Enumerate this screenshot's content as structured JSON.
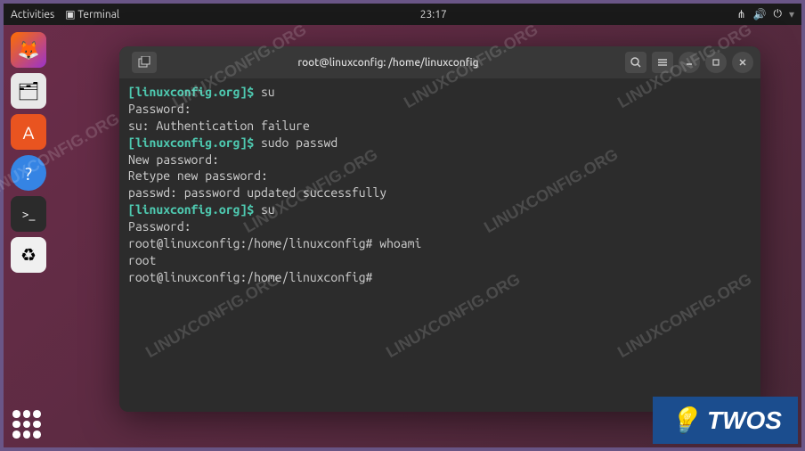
{
  "topbar": {
    "activities": "Activities",
    "app_label": "Terminal",
    "clock": "23:17"
  },
  "dock": {
    "firefox": "firefox",
    "files": "files",
    "software": "software",
    "help": "help",
    "terminal": "terminal",
    "trash": "trash",
    "apps": "apps"
  },
  "window": {
    "title": "root@linuxconfig: /home/linuxconfig",
    "titlebar": {
      "new_tab": "new-tab",
      "search": "search",
      "menu": "menu",
      "minimize": "minimize",
      "maximize": "maximize",
      "close": "close"
    }
  },
  "terminal": {
    "lines": [
      {
        "prompt": "[linuxconfig.org]$ ",
        "cmd": "su"
      },
      {
        "text": "Password:"
      },
      {
        "text": "su: Authentication failure"
      },
      {
        "prompt": "[linuxconfig.org]$ ",
        "cmd": "sudo passwd"
      },
      {
        "text": "New password:"
      },
      {
        "text": "Retype new password:"
      },
      {
        "text": "passwd: password updated successfully"
      },
      {
        "prompt": "[linuxconfig.org]$ ",
        "cmd": "su"
      },
      {
        "text": "Password:"
      },
      {
        "text": "root@linuxconfig:/home/linuxconfig# whoami"
      },
      {
        "text": "root"
      },
      {
        "text": "root@linuxconfig:/home/linuxconfig# "
      }
    ]
  },
  "watermark": "LINUXCONFIG.ORG",
  "badge": {
    "text": "TWOS"
  }
}
